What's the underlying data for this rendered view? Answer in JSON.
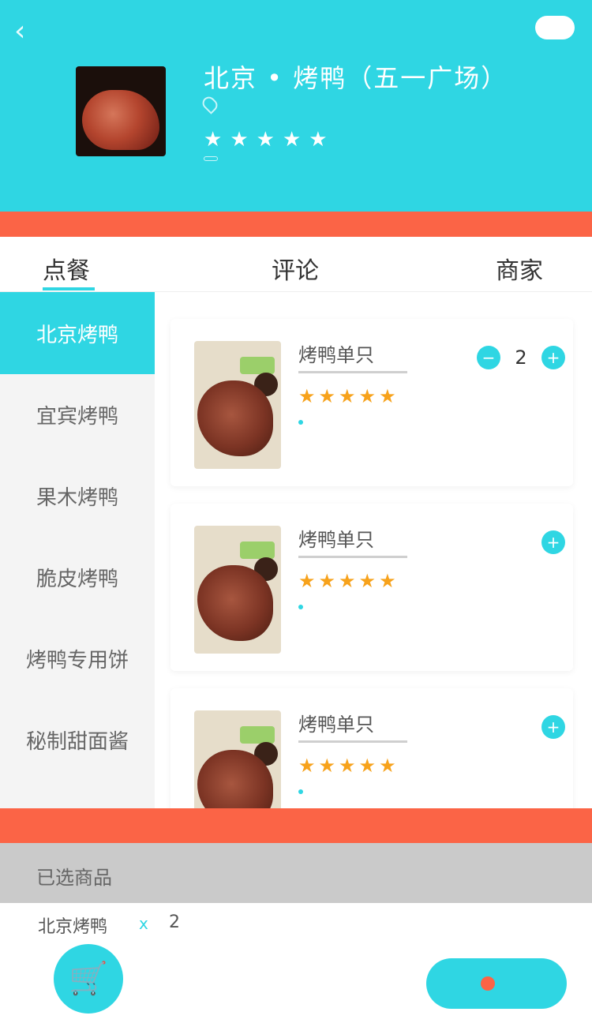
{
  "colors": {
    "accent": "#2fd6e3",
    "alert": "#fb6446",
    "star": "#f7a21b"
  },
  "header": {
    "back_icon": "‹",
    "pill_label": "",
    "logo_caption": "",
    "shop_name": "北京 • 烤鸭（五一广场）",
    "address": "",
    "delivery_tag": "",
    "delivery_text": "",
    "star_count": 5
  },
  "notice": "",
  "tabs": {
    "order": "点餐",
    "review": "评论",
    "merchant": "商家"
  },
  "sidebar": {
    "items": [
      {
        "label": "北京烤鸭",
        "active": true
      },
      {
        "label": "宜宾烤鸭"
      },
      {
        "label": "果木烤鸭"
      },
      {
        "label": "脆皮烤鸭"
      },
      {
        "label": "烤鸭专用饼"
      },
      {
        "label": "秘制甜面酱"
      },
      {
        "label": ""
      }
    ]
  },
  "items": [
    {
      "name": "烤鸭单只",
      "stars": 5,
      "stats": "",
      "price": "",
      "qty": "2",
      "minus": "−",
      "plus": "+"
    },
    {
      "name": "烤鸭单只",
      "stars": 5,
      "stats": "",
      "price": "",
      "plus": "+"
    },
    {
      "name": "烤鸭单只",
      "stars": 5,
      "stats": "",
      "price": "",
      "plus": "+"
    }
  ],
  "bottom": {
    "min_order": "",
    "selected_label": "已选商品",
    "selected_item": {
      "name": "北京烤鸭",
      "times": "x",
      "qty": "2",
      "price": ""
    },
    "cart_icon": "🛒",
    "total_price": "",
    "delivery_fee": "",
    "checkout_label": ""
  }
}
